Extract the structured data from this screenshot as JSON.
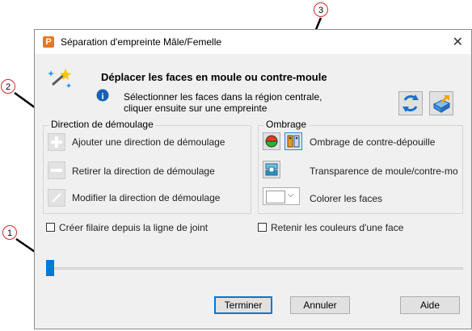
{
  "window": {
    "title": "Séparation d'empreinte Mâle/Femelle",
    "app_icon": "P"
  },
  "header": {
    "heading": "Déplacer les faces en moule ou contre-moule",
    "info_line1": "Sélectionner les faces dans la région centrale,",
    "info_line2": "cliquer ensuite sur une empreinte"
  },
  "direction_group": {
    "label": "Direction de démoulage",
    "items": [
      "Ajouter une direction de démoulage",
      "Retirer la direction de démoulage",
      "Modifier la direction de démoulage"
    ]
  },
  "shading_group": {
    "label": "Ombrage",
    "draft_shading": "Ombrage de contre-dépouille",
    "transparency": "Transparence de moule/contre-mo",
    "color_faces": "Colorer les faces"
  },
  "checkboxes": {
    "create_wireframe": "Créer filaire depuis la ligne de joint",
    "keep_colors": "Retenir les couleurs d'une face"
  },
  "slider": {
    "value": 0
  },
  "buttons": {
    "finish": "Terminer",
    "cancel": "Annuler",
    "help": "Aide"
  },
  "callouts": [
    "1",
    "2",
    "3"
  ]
}
